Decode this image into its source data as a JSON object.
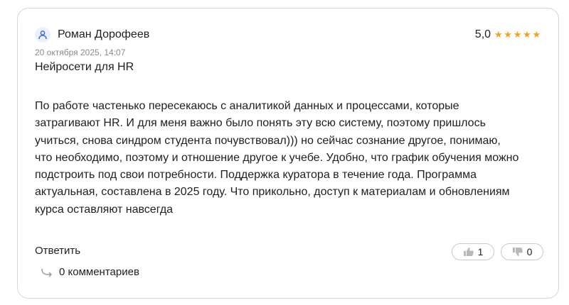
{
  "review": {
    "author": "Роман Дорофеев",
    "rating_value": "5,0",
    "stars": [
      "★",
      "★",
      "★",
      "★",
      "★"
    ],
    "date": "20 октября 2025, 14:07",
    "title": "Нейросети для HR",
    "body_lines": [
      "По работе частенько пересекаюсь с аналитикой данных и процессами, которые",
      "затрагивают HR. И для меня важно было понять эту всю систему, поэтому пришлось",
      "учиться, снова синдром студента почувствовал))) но сейчас сознание другое, понимаю,",
      "что необходимо, поэтому и отношение другое к учебе. Удобно, что график обучения можно",
      "подстроить под свои потребности. Поддержка куратора в течение года. Программа",
      "актуальная, составлена в 2025 году. Что прикольно, доступ к материалам и обновлениям",
      "курса оставляют навсегда"
    ],
    "reply_label": "Ответить",
    "comments_label": "0 комментариев",
    "likes": "1",
    "dislikes": "0"
  },
  "icons": {
    "avatar": "user-icon",
    "like": "thumbs-up-icon",
    "dislike": "thumbs-down-icon",
    "comments": "reply-arrow-icon"
  },
  "colors": {
    "star": "#f4a21a",
    "avatar_icon": "#3b6fd1",
    "avatar_bg": "#eaf1fb",
    "muted_text": "#8a8a8a",
    "border": "#d6d6d6"
  }
}
